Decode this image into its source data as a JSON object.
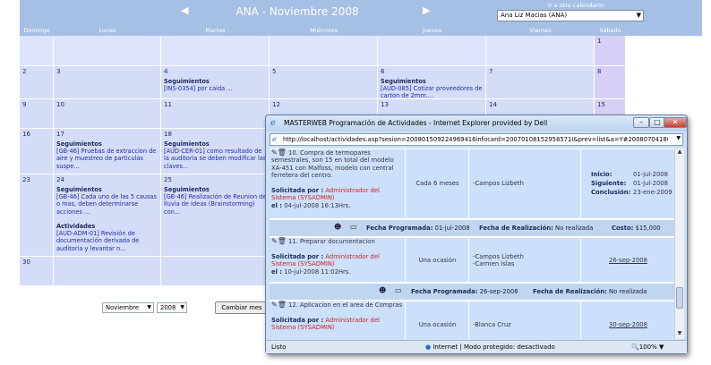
{
  "calendar": {
    "title": "ANA - Noviembre 2008",
    "other_calendar_label": "Ir a otro calendario:",
    "selected_calendar": "Ana Liz Macias (ANA)",
    "day_headers": [
      "Domingo",
      "Lunes",
      "Martes",
      "Miércoles",
      "Jueves",
      "Viernes",
      "Sábado"
    ],
    "days": {
      "d1": "1",
      "d2": "2",
      "d3": "3",
      "d4": "4",
      "d5": "5",
      "d6": "6",
      "d7": "7",
      "d8": "8",
      "d9": "9",
      "d10": "10",
      "d11": "11",
      "d12": "12",
      "d13": "13",
      "d14": "14",
      "d15": "15",
      "d16": "16",
      "d17": "17",
      "d18": "18",
      "d23": "23",
      "d24": "24",
      "d25": "25",
      "d30": "30"
    },
    "events": {
      "seg": "Seguimientos",
      "act": "Actividades",
      "e4": "[INS-0354] por caida ...",
      "e6": "[AUD-085] Cotizar proveedores de carton de 2mm....",
      "e17": "[GB-46] Pruebas de extraccion de aire y muestreo de particulas suspe...",
      "e18": "[AUD-CER-01] como resultado de la auditoria se deben modificar las claves...",
      "e24": "[GB-46] Cada uno de las 5 causas o mas, deben determinarse acciones ...",
      "e24b": "[AUD-ADM-01] Revisión de documentación derivada de auditoria y levantar n...",
      "e25": "[GB-46] Realización de Reunion de lluvia de Ideas (Brainstorming) con..."
    },
    "footer": {
      "month_value": "Noviembre",
      "year_value": "2008",
      "change_button": "Cambiar mes"
    }
  },
  "ie_window": {
    "title": "MASTERWEB Programación de Actividades - Internet Explorer provided by Dell",
    "url": "http://localhost/actividades.asp?sesion=200801509224969416infocard=20070108152958571I&prev=list&a=Y#2008070418C",
    "status_ready": "Listo",
    "status_zone": "Internet | Modo protegido: desactivado",
    "zoom": "100%",
    "activities": [
      {
        "text": "10. Compra de termopares semestrales, son 15 en total del modelo XA-451 con Malfoss, modelo con central ferretera del centro.",
        "frequency": "Cada 6 meses",
        "people": "-Campos Lizbeth",
        "requested_label": "Solicitada por :",
        "requested_by": "Administrador del Sistema (SYSADMIN)",
        "el_label": "el :",
        "el_value": "04-jul-2008 16:13Hrs.",
        "start_label": "Inicio:",
        "start": "01-jul-2008",
        "next_label": "Siguiente:",
        "next": "01-jul-2008",
        "end_label": "Conclusión:",
        "end": "23-ene-2009",
        "prog_label": "Fecha Programada:",
        "prog": "01-jul-2008",
        "real_label": "Fecha de Realización:",
        "real": "No realizada",
        "cost_label": "Costo:",
        "cost": "$15,000"
      },
      {
        "text": "11. Preparar documentacion",
        "frequency": "Una ocasión",
        "people": "-Campos Lizbeth\n-Carmen Islas",
        "requested_label": "Solicitada por :",
        "requested_by": "Administrador del Sistema (SYSADMIN)",
        "el_label": "el :",
        "el_value": "10-jul-2008 11:02Hrs.",
        "date": "26-sep-2008",
        "prog_label": "Fecha Programada:",
        "prog": "26-sep-2008",
        "real_label": "Fecha de Realización:",
        "real": "No realizada"
      },
      {
        "text": "12. Aplicacion en el area de Compras",
        "frequency": "Una ocasión",
        "people": "-Blanca Cruz",
        "requested_label": "Solicitada por :",
        "requested_by": "Administrador del Sistema (SYSADMIN)",
        "date": "30-sep-2008"
      }
    ]
  }
}
